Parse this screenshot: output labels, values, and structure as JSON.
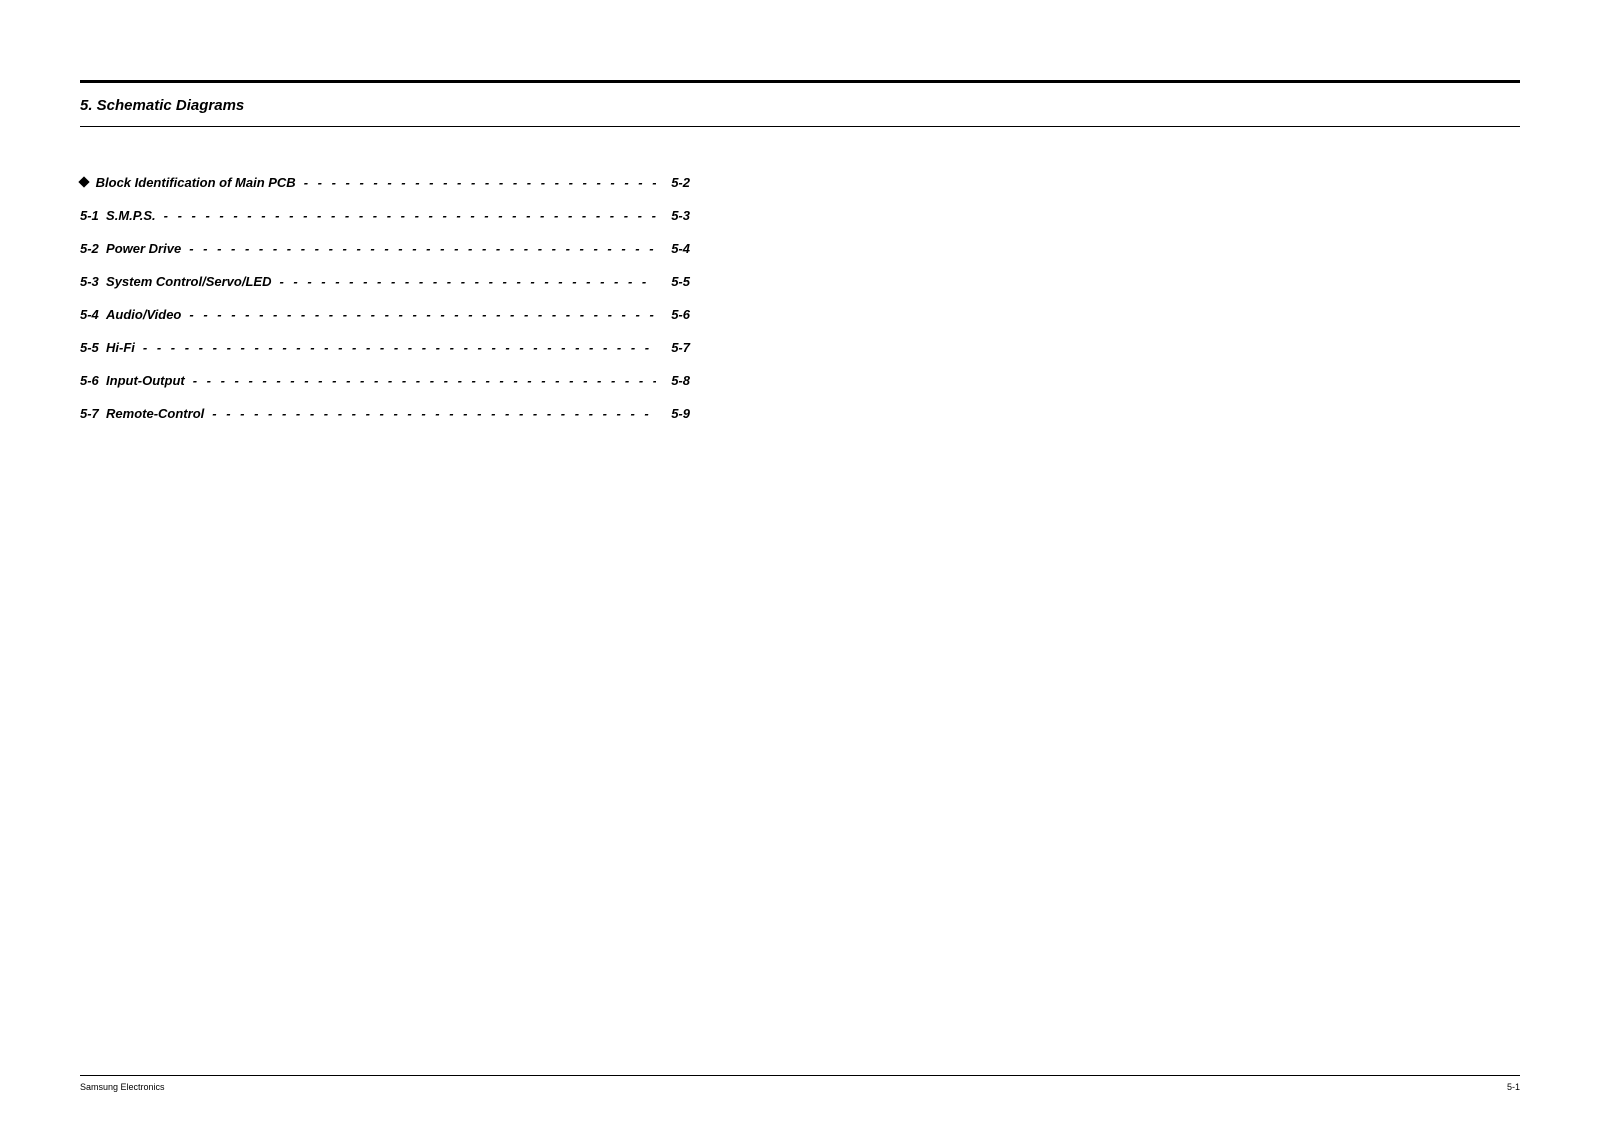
{
  "section_title": "5. Schematic Diagrams",
  "toc": [
    {
      "prefix_symbol": true,
      "label": "Block Identification of Main PCB",
      "page": "5-2"
    },
    {
      "prefix": "5-1",
      "label": "S.M.P.S.",
      "page": "5-3"
    },
    {
      "prefix": "5-2",
      "label": "Power Drive",
      "page": "5-4"
    },
    {
      "prefix": "5-3",
      "label": "System Control/Servo/LED",
      "page": "5-5"
    },
    {
      "prefix": "5-4",
      "label": "Audio/Video",
      "page": "5-6"
    },
    {
      "prefix": "5-5",
      "label": "Hi-Fi",
      "page": "5-7"
    },
    {
      "prefix": "5-6",
      "label": "Input-Output",
      "page": "5-8"
    },
    {
      "prefix": "5-7",
      "label": "Remote-Control",
      "page": "5-9"
    }
  ],
  "leader": "- - - - - - - - - - - - - - - - - - - - - - - - - - - - - - - - - - - - - - - - - - - - - - - - - - - - - - - - - - - - - - - - - - -",
  "footer": {
    "left": "Samsung Electronics",
    "right": "5-1"
  }
}
